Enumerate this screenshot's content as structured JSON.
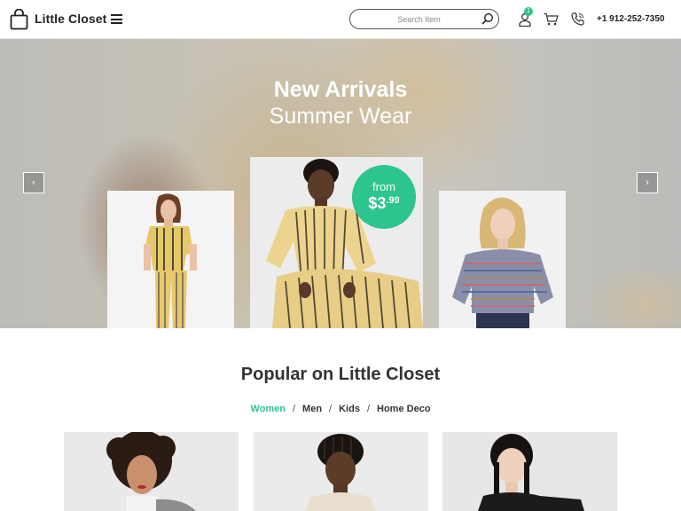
{
  "brand": {
    "name": "Little Closet",
    "logo_icon": "shopping-bag-icon"
  },
  "header": {
    "menu_icon": "hamburger-menu-icon",
    "search": {
      "placeholder": "Search Item",
      "value": "",
      "icon": "search-icon"
    },
    "user": {
      "icon": "user-icon",
      "badge_count": "1"
    },
    "cart": {
      "icon": "cart-icon"
    },
    "phone": {
      "icon": "phone-icon",
      "number": "+1 912-252-7350"
    }
  },
  "hero": {
    "title": "New Arrivals",
    "subtitle": "Summer Wear",
    "prev_arrow": "‹",
    "next_arrow": "›",
    "badge": {
      "label": "from",
      "price_main": "$3",
      "price_cents": ".99"
    },
    "slides": [
      "striped-suit-model",
      "striped-set-model",
      "striped-top-model"
    ]
  },
  "popular": {
    "title": "Popular on Little Closet",
    "filters": [
      {
        "label": "Women",
        "active": true
      },
      {
        "label": "Men",
        "active": false
      },
      {
        "label": "Kids",
        "active": false
      },
      {
        "label": "Home Deco",
        "active": false
      }
    ],
    "separator": "/"
  },
  "colors": {
    "accent": "#2dc58e",
    "text": "#222222"
  }
}
